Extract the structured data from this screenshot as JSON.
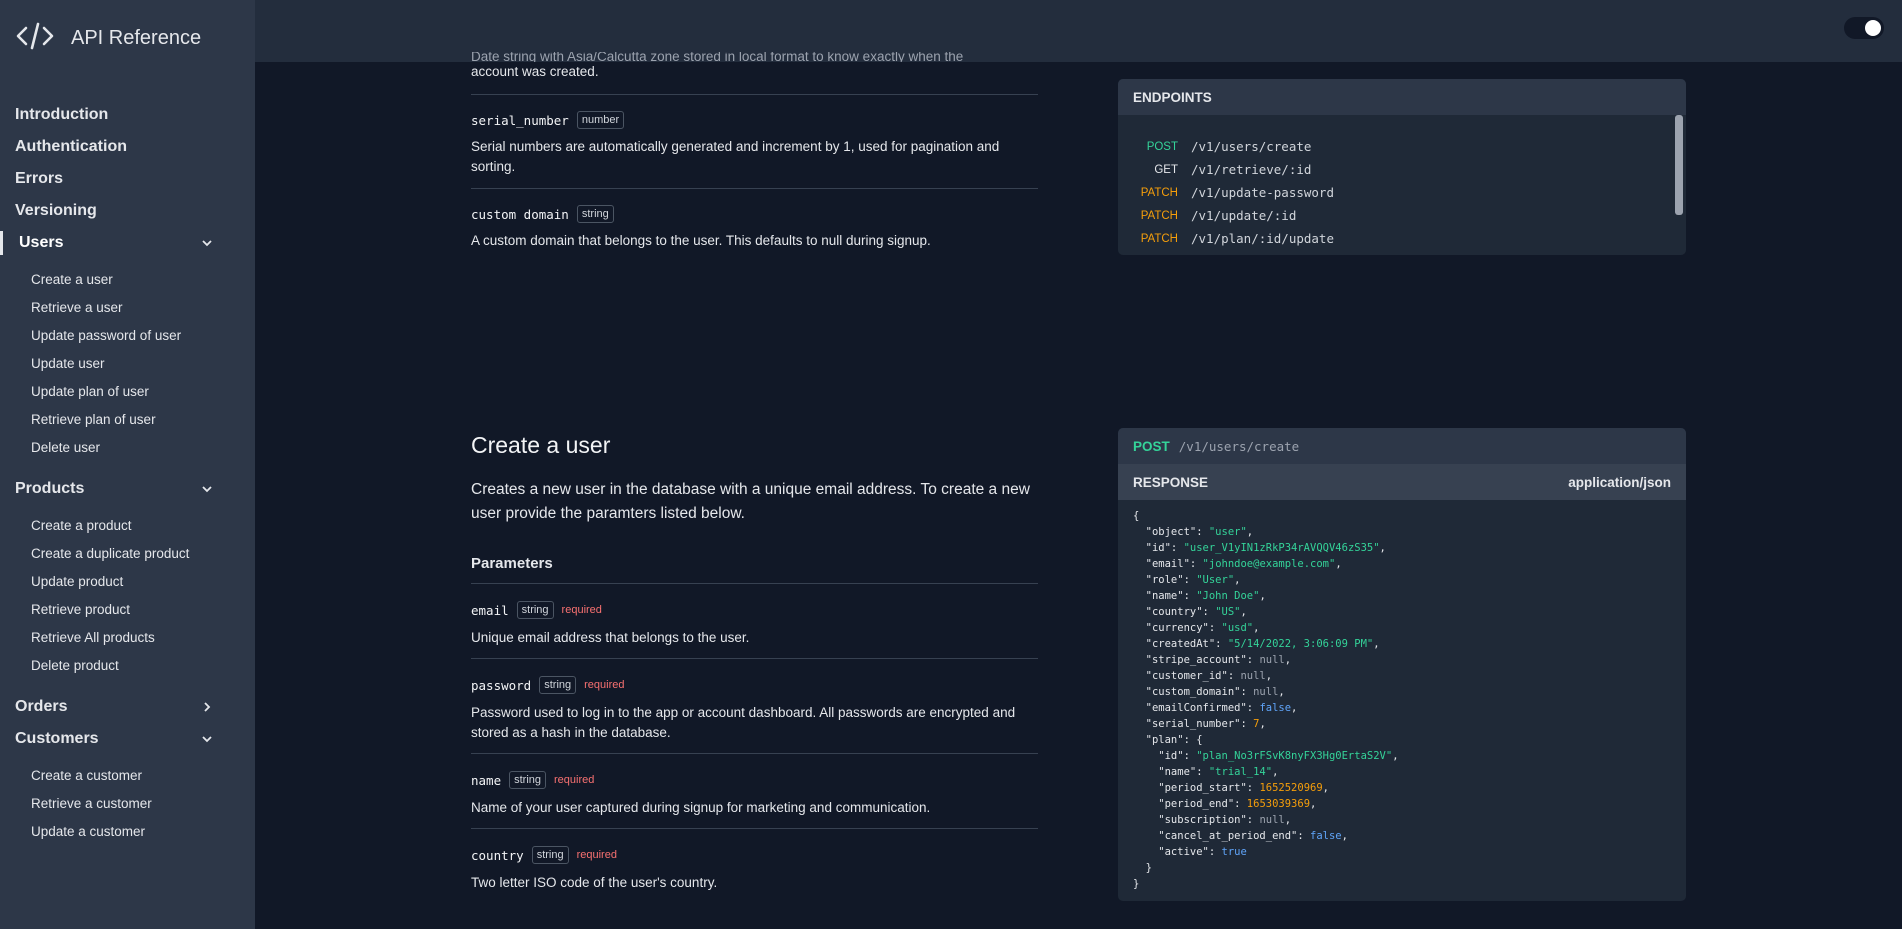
{
  "app": {
    "title": "API Reference"
  },
  "sidebar": {
    "items": [
      {
        "label": "Introduction"
      },
      {
        "label": "Authentication"
      },
      {
        "label": "Errors"
      },
      {
        "label": "Versioning"
      }
    ],
    "users": {
      "label": "Users",
      "subitems": [
        "Create a user",
        "Retrieve a user",
        "Update password of user",
        "Update user",
        "Update plan of user",
        "Retrieve plan of user",
        "Delete user"
      ]
    },
    "products": {
      "label": "Products",
      "subitems": [
        "Create a product",
        "Create a duplicate product",
        "Update product",
        "Retrieve product",
        "Retrieve All products",
        "Delete product"
      ]
    },
    "orders": {
      "label": "Orders"
    },
    "customers": {
      "label": "Customers",
      "subitems": [
        "Create a customer",
        "Retrieve a customer",
        "Update a customer"
      ]
    }
  },
  "top_doc": {
    "partial_desc_1": "Date string with Asia/Calcutta zone stored in local format to know exactly when the",
    "partial_desc_2": "account was created.",
    "params": [
      {
        "name": "serial_number",
        "type": "number",
        "desc": "Serial numbers are automatically generated and increment by 1, used for pagination and sorting."
      },
      {
        "name": "custom domain",
        "type": "string",
        "desc": "A custom domain that belongs to the user. This defaults to null during signup."
      }
    ]
  },
  "endpoints": {
    "title": "ENDPOINTS",
    "items": [
      {
        "method": "POST",
        "path": "/v1/users/create",
        "color": "#34d399"
      },
      {
        "method": "GET",
        "path": "/v1/retrieve/:id",
        "color": "#e5e7eb"
      },
      {
        "method": "PATCH",
        "path": "/v1/update-password",
        "color": "#f59e0b"
      },
      {
        "method": "PATCH",
        "path": "/v1/update/:id",
        "color": "#f59e0b"
      },
      {
        "method": "PATCH",
        "path": "/v1/plan/:id/update",
        "color": "#f59e0b"
      }
    ]
  },
  "create_user": {
    "title": "Create a user",
    "desc": "Creates a new user in the database with a unique email address. To create a new user provide the paramters listed below.",
    "params_heading": "Parameters",
    "params": [
      {
        "name": "email",
        "type": "string",
        "required": "required",
        "desc": "Unique email address that belongs to the user."
      },
      {
        "name": "password",
        "type": "string",
        "required": "required",
        "desc": "Password used to log in to the app or account dashboard. All passwords are encrypted and stored as a hash in the database."
      },
      {
        "name": "name",
        "type": "string",
        "required": "required",
        "desc": "Name of your user captured during signup for marketing and communication."
      },
      {
        "name": "country",
        "type": "string",
        "required": "required",
        "desc": "Two letter ISO code of the user's country."
      }
    ]
  },
  "request_panel": {
    "method": "POST",
    "path": "/v1/users/create",
    "response_label": "RESPONSE",
    "content_type": "application/json"
  },
  "response_json": {
    "open": "{",
    "close": "}",
    "object": "\"user\"",
    "id": "\"user_V1yIN1zRkP34rAVQQV46zS35\"",
    "email": "\"johndoe@example.com\"",
    "role": "\"User\"",
    "name": "\"John Doe\"",
    "country": "\"US\"",
    "currency": "\"usd\"",
    "createdAt": "\"5/14/2022, 3:06:09 PM\"",
    "stripe_account": "null",
    "customer_id": "null",
    "custom_domain": "null",
    "emailConfirmed": "false",
    "serial_number": "7",
    "plan_id": "\"plan_No3rFSvK8nyFX3Hg0ErtaS2V\"",
    "plan_name": "\"trial_14\"",
    "period_start": "1652520969",
    "period_end": "1653039369",
    "subscription": "null",
    "cancel_at_period_end": "false",
    "active": "true"
  }
}
